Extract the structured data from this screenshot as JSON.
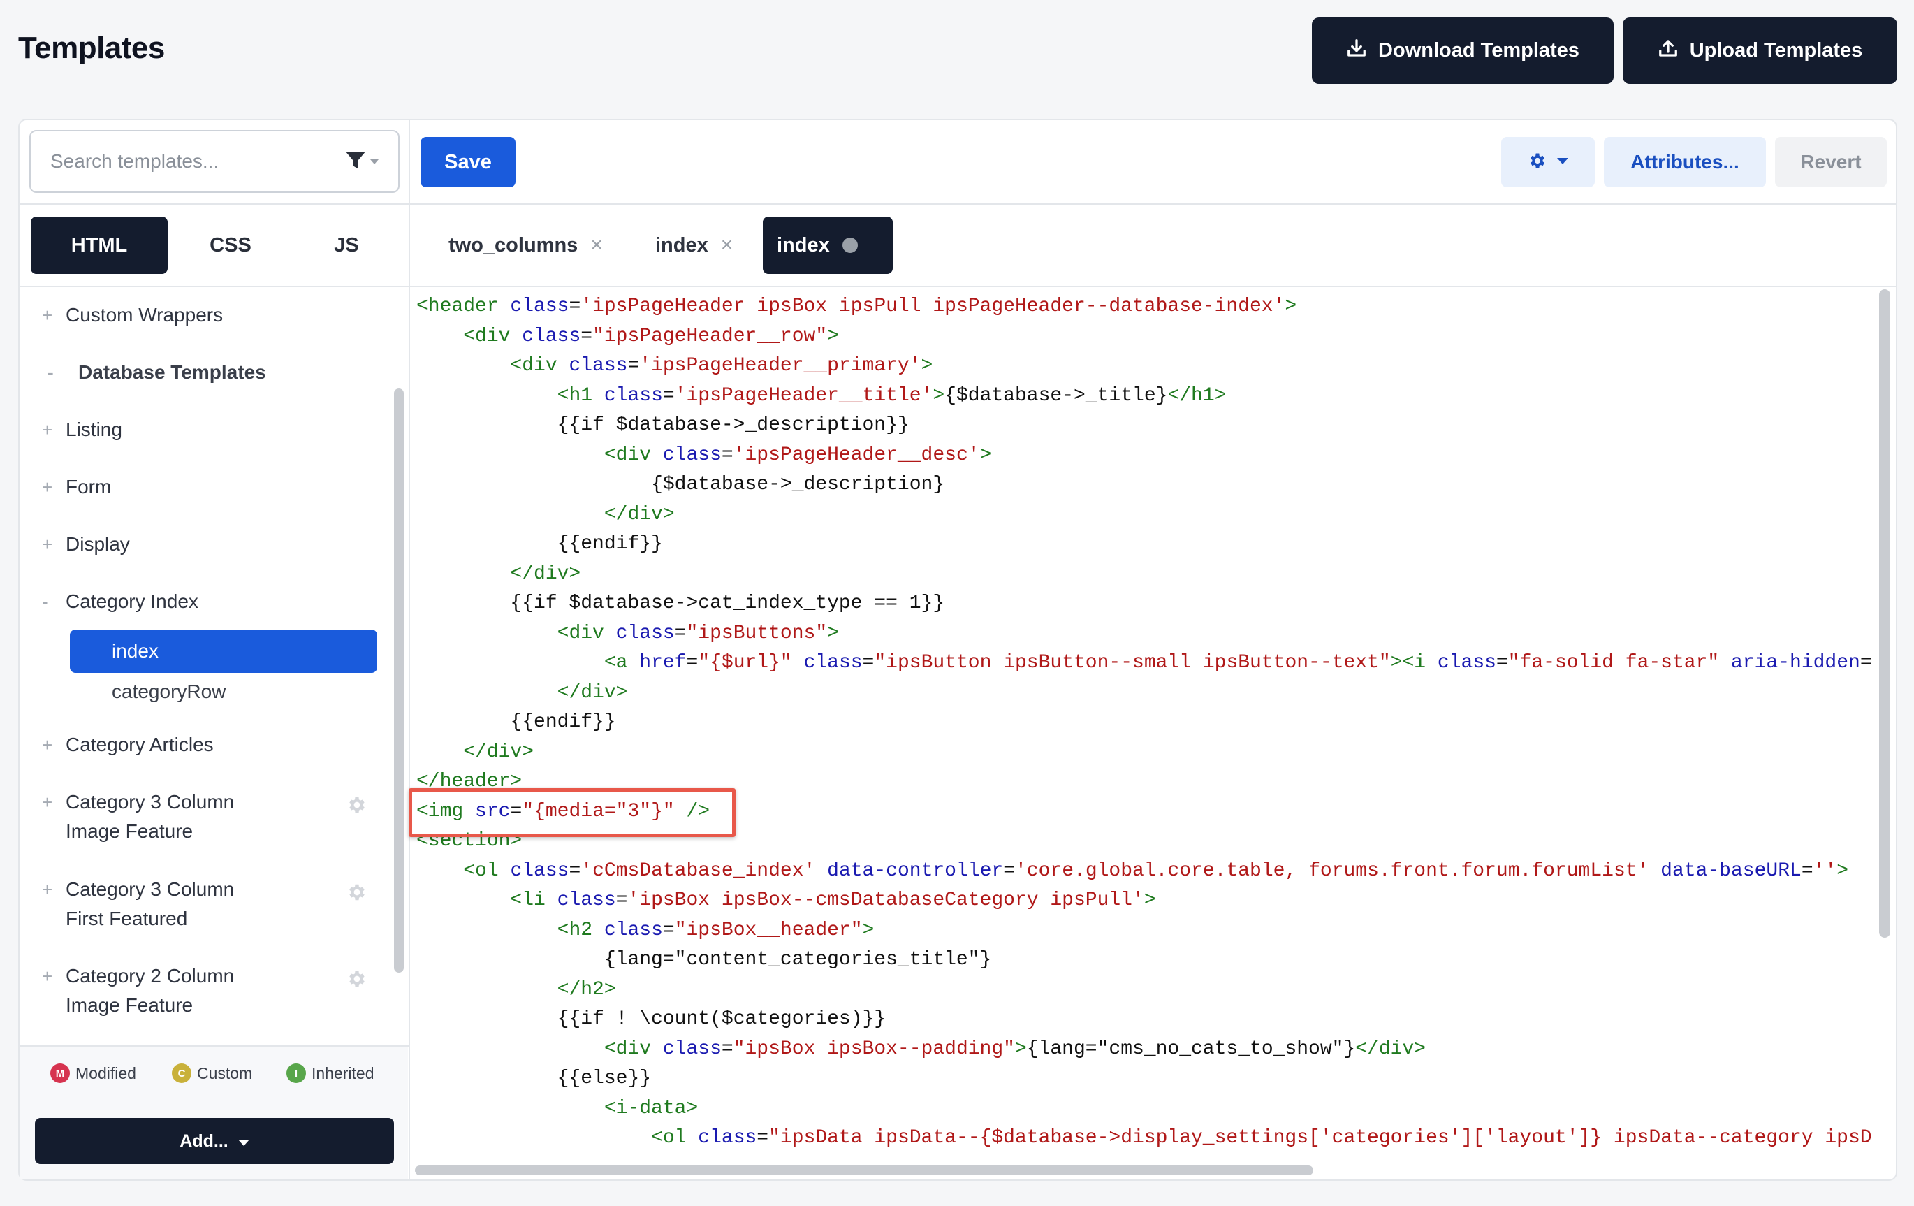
{
  "header": {
    "title": "Templates",
    "download_label": "Download Templates",
    "upload_label": "Upload Templates"
  },
  "search": {
    "placeholder": "Search templates..."
  },
  "toolbar": {
    "save_label": "Save",
    "attributes_label": "Attributes...",
    "revert_label": "Revert"
  },
  "lang_tabs": [
    "HTML",
    "CSS",
    "JS"
  ],
  "editor_tabs": [
    "two_columns",
    "index",
    "index"
  ],
  "tree": {
    "custom_wrappers": "Custom Wrappers",
    "database_templates": "Database Templates",
    "listing": "Listing",
    "form": "Form",
    "display": "Display",
    "category_index": "Category Index",
    "index": "index",
    "category_row": "categoryRow",
    "category_articles": "Category Articles",
    "cat3_image_1": "Category 3 Column",
    "cat3_image_2": "Image Feature",
    "cat3_first_1": "Category 3 Column",
    "cat3_first_2": "First Featured",
    "cat2_image_1": "Category 2 Column",
    "cat2_image_2": "Image Feature"
  },
  "legend": {
    "modified": "Modified",
    "custom": "Custom",
    "inherited": "Inherited",
    "modified_letter": "M",
    "custom_letter": "C",
    "inherited_letter": "I"
  },
  "add_label": "Add...",
  "colors": {
    "accent": "#1a5bdc",
    "dark": "#141c2e",
    "highlight": "#e8584a"
  },
  "code_lines": [
    [
      [
        "t",
        "<header "
      ],
      [
        "a",
        "class"
      ],
      [
        "p",
        "="
      ],
      [
        "s",
        "'ipsPageHeader ipsBox ipsPull ipsPageHeader--database-index'"
      ],
      [
        "t",
        ">"
      ]
    ],
    [
      [
        "p",
        "    "
      ],
      [
        "t",
        "<div "
      ],
      [
        "a",
        "class"
      ],
      [
        "p",
        "="
      ],
      [
        "s",
        "\"ipsPageHeader__row\""
      ],
      [
        "t",
        ">"
      ]
    ],
    [
      [
        "p",
        "        "
      ],
      [
        "t",
        "<div "
      ],
      [
        "a",
        "class"
      ],
      [
        "p",
        "="
      ],
      [
        "s",
        "'ipsPageHeader__primary'"
      ],
      [
        "t",
        ">"
      ]
    ],
    [
      [
        "p",
        "            "
      ],
      [
        "t",
        "<h1 "
      ],
      [
        "a",
        "class"
      ],
      [
        "p",
        "="
      ],
      [
        "s",
        "'ipsPageHeader__title'"
      ],
      [
        "t",
        ">"
      ],
      [
        "p",
        "{$database->_title}"
      ],
      [
        "t",
        "</h1>"
      ]
    ],
    [
      [
        "p",
        "            {{if $database->_description}}"
      ]
    ],
    [
      [
        "p",
        "                "
      ],
      [
        "t",
        "<div "
      ],
      [
        "a",
        "class"
      ],
      [
        "p",
        "="
      ],
      [
        "s",
        "'ipsPageHeader__desc'"
      ],
      [
        "t",
        ">"
      ]
    ],
    [
      [
        "p",
        "                    {$database->_description}"
      ]
    ],
    [
      [
        "p",
        "                "
      ],
      [
        "t",
        "</div>"
      ]
    ],
    [
      [
        "p",
        "            {{endif}}"
      ]
    ],
    [
      [
        "p",
        "        "
      ],
      [
        "t",
        "</div>"
      ]
    ],
    [
      [
        "p",
        "        {{if $database->cat_index_type == 1}}"
      ]
    ],
    [
      [
        "p",
        "            "
      ],
      [
        "t",
        "<div "
      ],
      [
        "a",
        "class"
      ],
      [
        "p",
        "="
      ],
      [
        "s",
        "\"ipsButtons\""
      ],
      [
        "t",
        ">"
      ]
    ],
    [
      [
        "p",
        "                "
      ],
      [
        "t",
        "<a "
      ],
      [
        "a",
        "href"
      ],
      [
        "p",
        "="
      ],
      [
        "s",
        "\"{$url}\""
      ],
      [
        "p",
        " "
      ],
      [
        "a",
        "class"
      ],
      [
        "p",
        "="
      ],
      [
        "s",
        "\"ipsButton ipsButton--small ipsButton--text\""
      ],
      [
        "t",
        "><i "
      ],
      [
        "a",
        "class"
      ],
      [
        "p",
        "="
      ],
      [
        "s",
        "\"fa-solid fa-star\""
      ],
      [
        "p",
        " "
      ],
      [
        "a",
        "aria-hidden"
      ],
      [
        "p",
        "="
      ]
    ],
    [
      [
        "p",
        "            "
      ],
      [
        "t",
        "</div>"
      ]
    ],
    [
      [
        "p",
        "        {{endif}}"
      ]
    ],
    [
      [
        "p",
        "    "
      ],
      [
        "t",
        "</div>"
      ]
    ],
    [
      [
        "t",
        "</header>"
      ]
    ],
    [
      [
        "t",
        "<img "
      ],
      [
        "a",
        "src"
      ],
      [
        "p",
        "="
      ],
      [
        "s",
        "\"{media=\"3\"}\""
      ],
      [
        "p",
        " "
      ],
      [
        "t",
        "/>"
      ]
    ],
    [
      [
        "t",
        "<section>"
      ]
    ],
    [
      [
        "p",
        "    "
      ],
      [
        "t",
        "<ol "
      ],
      [
        "a",
        "class"
      ],
      [
        "p",
        "="
      ],
      [
        "s",
        "'cCmsDatabase_index'"
      ],
      [
        "p",
        " "
      ],
      [
        "a",
        "data-controller"
      ],
      [
        "p",
        "="
      ],
      [
        "s",
        "'core.global.core.table, forums.front.forum.forumList'"
      ],
      [
        "p",
        " "
      ],
      [
        "a",
        "data-baseURL"
      ],
      [
        "p",
        "="
      ],
      [
        "s",
        "''"
      ],
      [
        "t",
        ">"
      ]
    ],
    [
      [
        "p",
        "        "
      ],
      [
        "t",
        "<li "
      ],
      [
        "a",
        "class"
      ],
      [
        "p",
        "="
      ],
      [
        "s",
        "'ipsBox ipsBox--cmsDatabaseCategory ipsPull'"
      ],
      [
        "t",
        ">"
      ]
    ],
    [
      [
        "p",
        "            "
      ],
      [
        "t",
        "<h2 "
      ],
      [
        "a",
        "class"
      ],
      [
        "p",
        "="
      ],
      [
        "s",
        "\"ipsBox__header\""
      ],
      [
        "t",
        ">"
      ]
    ],
    [
      [
        "p",
        "                {lang=\"content_categories_title\"}"
      ]
    ],
    [
      [
        "p",
        "            "
      ],
      [
        "t",
        "</h2>"
      ]
    ],
    [
      [
        "p",
        "            {{if ! \\count($categories)}}"
      ]
    ],
    [
      [
        "p",
        "                "
      ],
      [
        "t",
        "<div "
      ],
      [
        "a",
        "class"
      ],
      [
        "p",
        "="
      ],
      [
        "s",
        "\"ipsBox ipsBox--padding\""
      ],
      [
        "t",
        ">"
      ],
      [
        "p",
        "{lang=\"cms_no_cats_to_show\"}"
      ],
      [
        "t",
        "</div>"
      ]
    ],
    [
      [
        "p",
        "            {{else}}"
      ]
    ],
    [
      [
        "p",
        "                "
      ],
      [
        "t",
        "<i-data>"
      ]
    ],
    [
      [
        "p",
        "                    "
      ],
      [
        "t",
        "<ol "
      ],
      [
        "a",
        "class"
      ],
      [
        "p",
        "="
      ],
      [
        "s",
        "\"ipsData ipsData--{$database->display_settings['categories']['layout']} ipsData--category ipsD"
      ]
    ]
  ]
}
